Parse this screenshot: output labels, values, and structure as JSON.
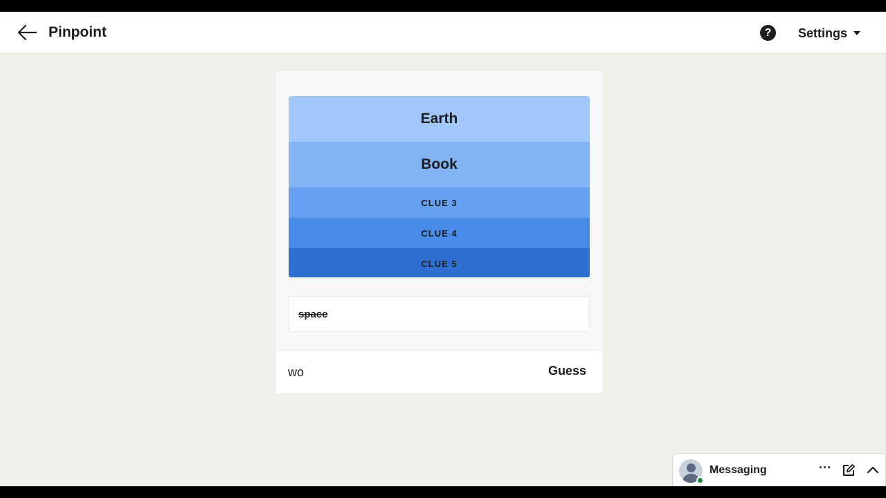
{
  "header": {
    "title": "Pinpoint",
    "help_symbol": "?",
    "settings_label": "Settings"
  },
  "icons": {
    "back": "arrow-left-icon",
    "help": "question-circle-icon",
    "settings_caret": "caret-down-icon",
    "more": "ellipsis-icon",
    "compose": "compose-icon",
    "expand": "chevron-up-icon"
  },
  "game": {
    "clues": [
      {
        "label": "Earth",
        "color": "#a2c8fb"
      },
      {
        "label": "Book",
        "color": "#82b3f5"
      },
      {
        "label": "CLUE 3",
        "color": "#66a0f0"
      },
      {
        "label": "CLUE 4",
        "color": "#498be9"
      },
      {
        "label": "CLUE 5",
        "color": "#2e6fd1"
      }
    ],
    "wrong_guesses": [
      "space"
    ],
    "input_value": "wo",
    "guess_label": "Guess"
  },
  "messaging": {
    "label": "Messaging",
    "more_symbol": "···",
    "online_color": "#1f8a3f"
  }
}
